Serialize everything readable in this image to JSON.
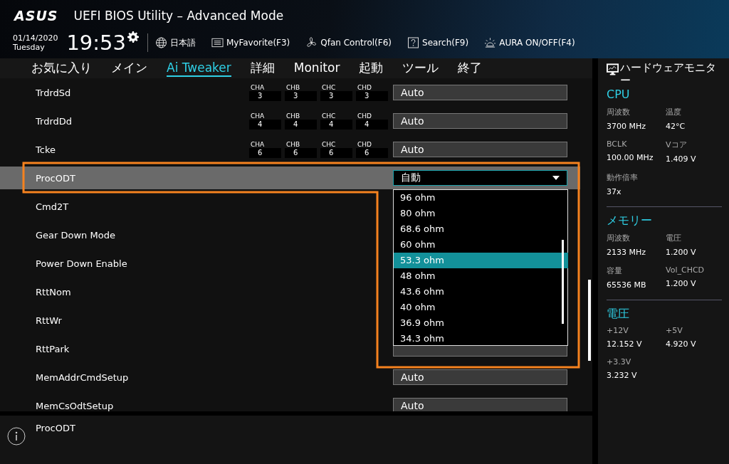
{
  "header": {
    "logo": "ASUS",
    "title": "UEFI BIOS Utility – Advanced Mode",
    "date": "01/14/2020",
    "day": "Tuesday",
    "time": "19:53",
    "tools": [
      {
        "kind": "language",
        "label": "日本語"
      },
      {
        "kind": "favorite",
        "label": "MyFavorite(F3)"
      },
      {
        "kind": "fan",
        "label": "Qfan Control(F6)"
      },
      {
        "kind": "search",
        "label": "Search(F9)"
      },
      {
        "kind": "aura",
        "label": "AURA ON/OFF(F4)"
      }
    ]
  },
  "tabs": [
    {
      "label": "お気に入り",
      "selected": false
    },
    {
      "label": "メイン",
      "selected": false
    },
    {
      "label": "Ai Tweaker",
      "selected": true
    },
    {
      "label": "詳細",
      "selected": false
    },
    {
      "label": "Monitor",
      "selected": false
    },
    {
      "label": "起動",
      "selected": false
    },
    {
      "label": "ツール",
      "selected": false
    },
    {
      "label": "終了",
      "selected": false
    }
  ],
  "settings": [
    {
      "name": "TrdrdSd",
      "selected": false,
      "value": "Auto",
      "channels": [
        {
          "label": "CHA",
          "value": "3"
        },
        {
          "label": "CHB",
          "value": "3"
        },
        {
          "label": "CHC",
          "value": "3"
        },
        {
          "label": "CHD",
          "value": "3"
        }
      ]
    },
    {
      "name": "TrdrdDd",
      "selected": false,
      "value": "Auto",
      "channels": [
        {
          "label": "CHA",
          "value": "4"
        },
        {
          "label": "CHB",
          "value": "4"
        },
        {
          "label": "CHC",
          "value": "4"
        },
        {
          "label": "CHD",
          "value": "4"
        }
      ]
    },
    {
      "name": "Tcke",
      "selected": false,
      "value": "Auto",
      "channels": [
        {
          "label": "CHA",
          "value": "6"
        },
        {
          "label": "CHB",
          "value": "6"
        },
        {
          "label": "CHC",
          "value": "6"
        },
        {
          "label": "CHD",
          "value": "6"
        }
      ]
    },
    {
      "name": "ProcODT",
      "selected": true,
      "value": "自動",
      "expanded": true,
      "options": [
        {
          "label": "96 ohm",
          "selected": false
        },
        {
          "label": "80 ohm",
          "selected": false
        },
        {
          "label": "68.6 ohm",
          "selected": false
        },
        {
          "label": "60 ohm",
          "selected": false
        },
        {
          "label": "53.3 ohm",
          "selected": true
        },
        {
          "label": "48 ohm",
          "selected": false
        },
        {
          "label": "43.6 ohm",
          "selected": false
        },
        {
          "label": "40 ohm",
          "selected": false
        },
        {
          "label": "36.9 ohm",
          "selected": false
        },
        {
          "label": "34.3 ohm",
          "selected": false
        }
      ]
    },
    {
      "name": "Cmd2T",
      "selected": false
    },
    {
      "name": "Gear Down Mode",
      "selected": false
    },
    {
      "name": "Power Down Enable",
      "selected": false
    },
    {
      "name": "RttNom",
      "selected": false
    },
    {
      "name": "RttWr",
      "selected": false
    },
    {
      "name": "RttPark",
      "selected": false,
      "field": true
    },
    {
      "name": "MemAddrCmdSetup",
      "selected": false,
      "value": "Auto"
    },
    {
      "name": "MemCsOdtSetup",
      "selected": false,
      "value": "Auto"
    }
  ],
  "info": {
    "text": "ProcODT"
  },
  "monitor": {
    "title": "ハードウェアモニター",
    "sections": [
      {
        "title": "CPU",
        "items": [
          {
            "label": "周波数",
            "value": "3700 MHz"
          },
          {
            "label": "温度",
            "value": "42°C"
          },
          {
            "label": "BCLK",
            "value": "100.00 MHz"
          },
          {
            "label": "Vコア",
            "value": "1.409 V"
          },
          {
            "label": "動作倍率",
            "value": "37x"
          }
        ]
      },
      {
        "title": "メモリー",
        "items": [
          {
            "label": "周波数",
            "value": "2133 MHz"
          },
          {
            "label": "電圧",
            "value": "1.200 V"
          },
          {
            "label": "容量",
            "value": "65536 MB"
          },
          {
            "label": "Vol_CHCD",
            "value": "1.200 V"
          }
        ]
      },
      {
        "title": "電圧",
        "items": [
          {
            "label": "+12V",
            "value": "12.152 V"
          },
          {
            "label": "+5V",
            "value": "4.920 V"
          },
          {
            "label": "+3.3V",
            "value": "3.232 V"
          }
        ]
      }
    ]
  }
}
